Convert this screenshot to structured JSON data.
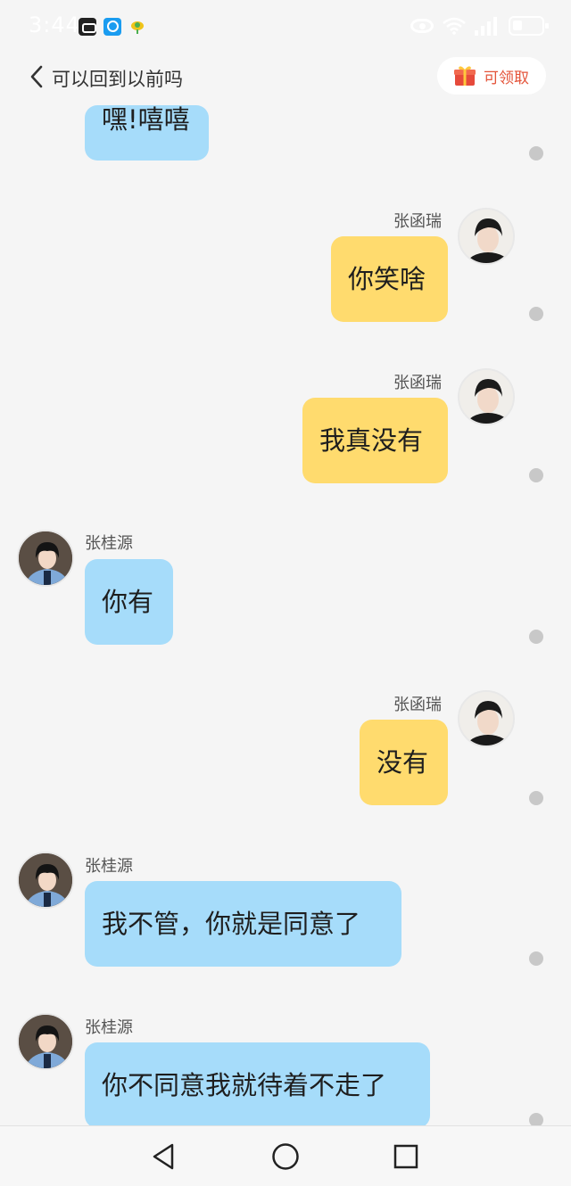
{
  "status_bar": {
    "time": "3:44",
    "app_icons": [
      "message-app-icon",
      "search-app-icon",
      "bird-app-icon"
    ],
    "right_icons": [
      "eye-icon",
      "wifi-icon",
      "signal-icon",
      "battery-icon"
    ]
  },
  "header": {
    "title": "可以回到以前吗",
    "reward_label": "可领取",
    "reward_color": "#e4543a"
  },
  "colors": {
    "own_bubble": "#ffdb6e",
    "other_bubble": "#a6dcfa",
    "background": "#f5f5f5"
  },
  "messages": [
    {
      "side": "left",
      "text": "嘿!嘻嘻"
    },
    {
      "side": "right",
      "sender": "张函瑞",
      "text": "你笑啥"
    },
    {
      "side": "right",
      "sender": "张函瑞",
      "text": "我真没有"
    },
    {
      "side": "left",
      "sender": "张桂源",
      "text": "你有"
    },
    {
      "side": "right",
      "sender": "张函瑞",
      "text": "没有"
    },
    {
      "side": "left",
      "sender": "张桂源",
      "text": "我不管，你就是同意了"
    },
    {
      "side": "left",
      "sender": "张桂源",
      "text": "你不同意我就待着不走了"
    }
  ],
  "nav": {
    "icons": [
      "back-triangle-icon",
      "home-circle-icon",
      "recents-square-icon"
    ]
  }
}
